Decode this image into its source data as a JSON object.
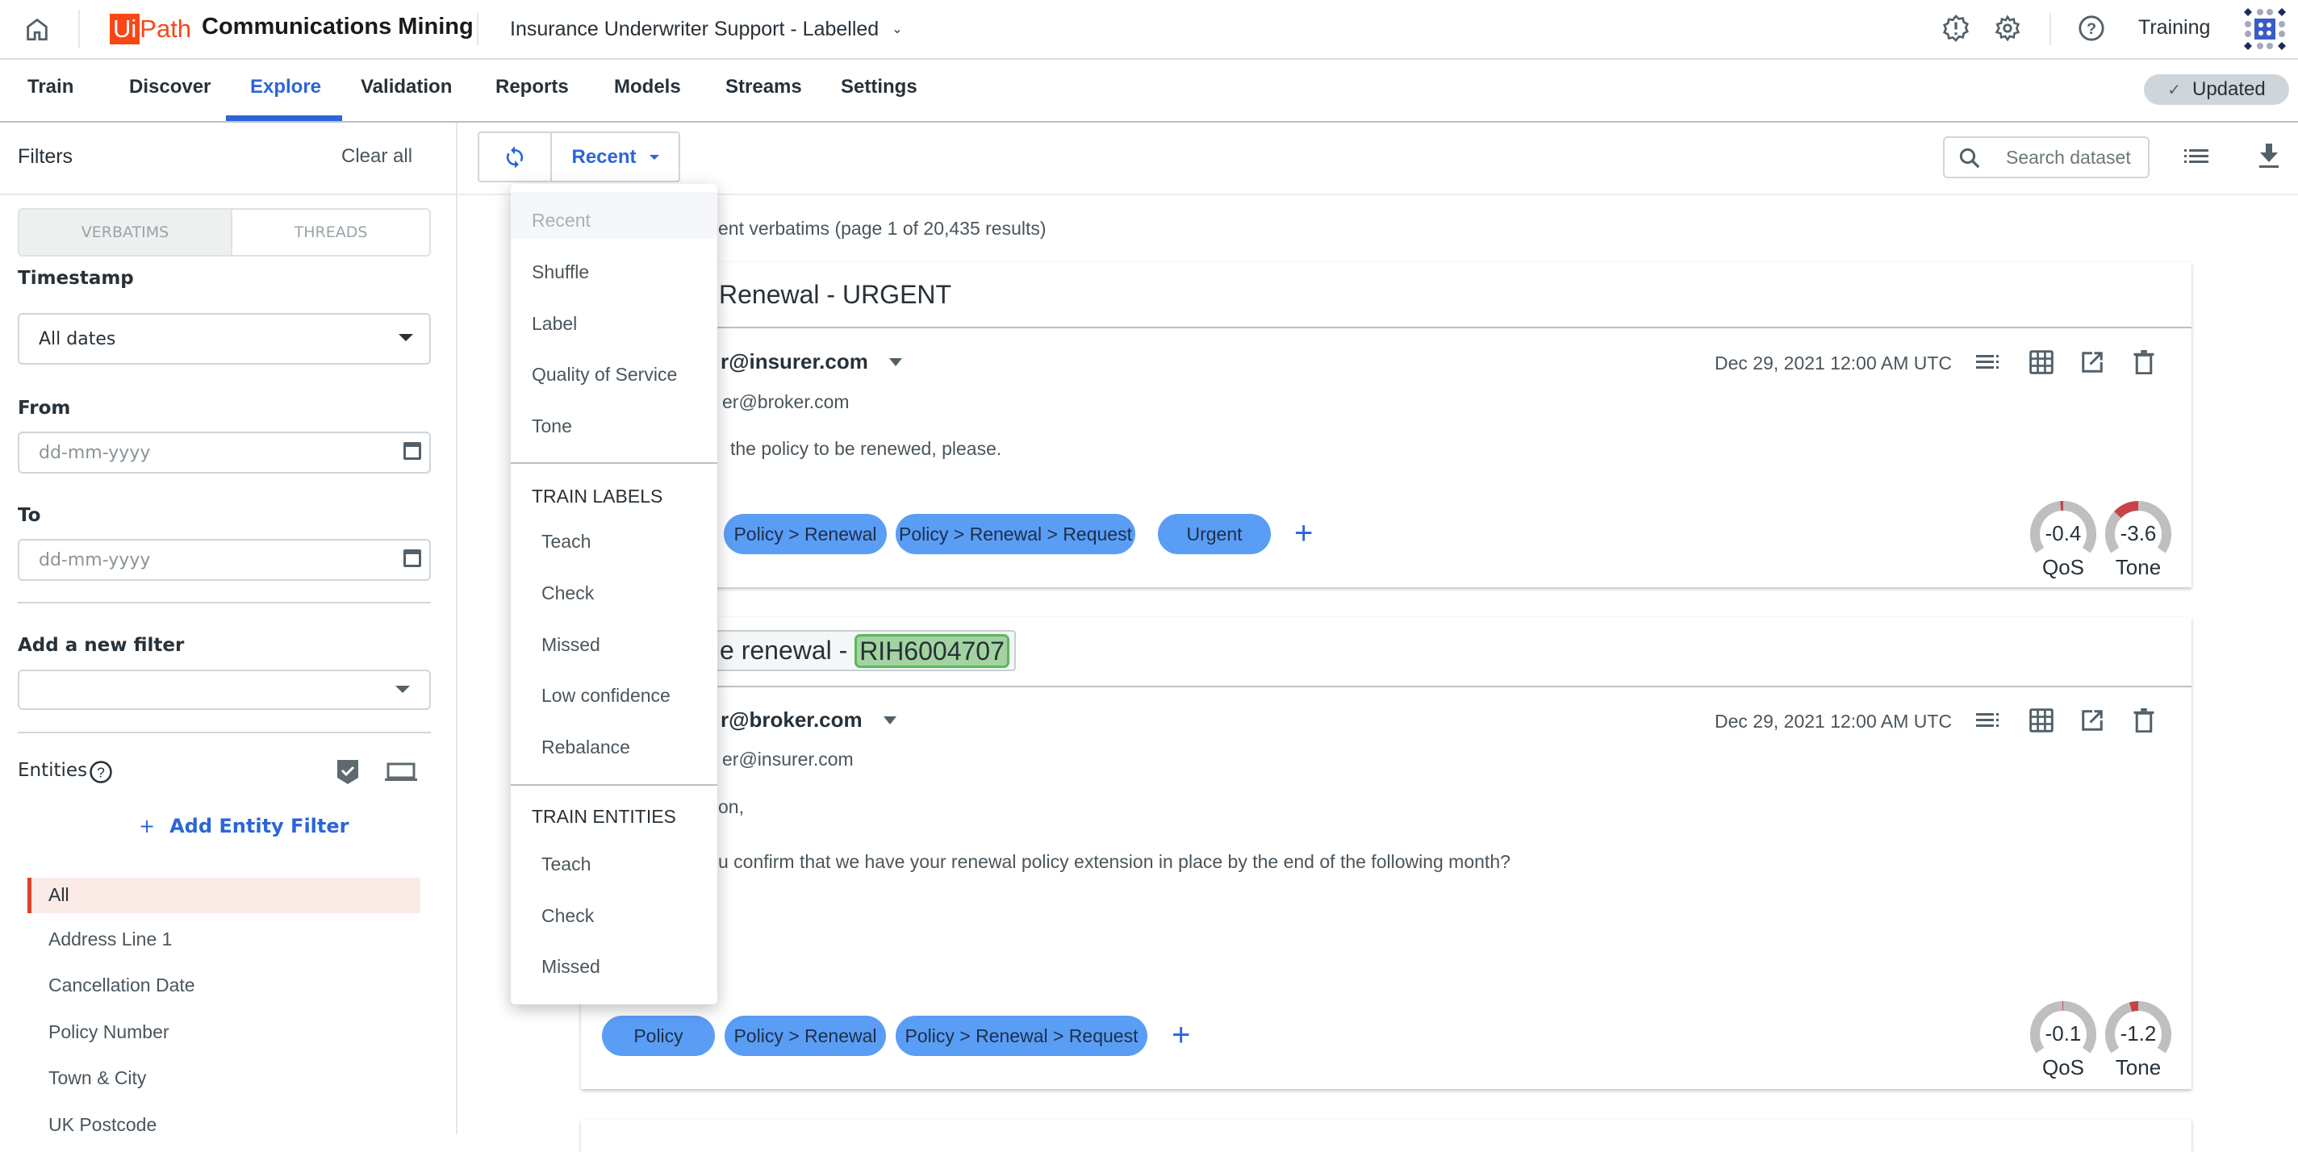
{
  "header": {
    "brand_logo": "UiPath",
    "product": "Communications Mining",
    "dataset": "Insurance Underwriter Support - Labelled",
    "user": "Training"
  },
  "nav": {
    "tabs": [
      "Train",
      "Discover",
      "Explore",
      "Validation",
      "Reports",
      "Models",
      "Streams",
      "Settings"
    ],
    "active": "Explore",
    "status": "Updated"
  },
  "colors": {
    "accent": "#2c66d6",
    "brand": "#fa4616",
    "label_pill": "#5a9df5",
    "entity": "#a3d3a0",
    "gauge_negative": "#c8424a"
  },
  "filters": {
    "title": "Filters",
    "clear_all": "Clear all",
    "toggle": [
      "VERBATIMS",
      "THREADS"
    ],
    "timestamp_label": "Timestamp",
    "timestamp_value": "All dates",
    "from_label": "From",
    "from_placeholder": "dd-mm-yyyy",
    "to_label": "To",
    "to_placeholder": "dd-mm-yyyy",
    "add_filter_label": "Add a new filter",
    "entities_label": "Entities",
    "add_entity_filter": "Add Entity Filter",
    "entities": [
      "All",
      "Address Line 1",
      "Cancellation Date",
      "Policy Number",
      "Town & City",
      "UK Postcode"
    ]
  },
  "toolbar": {
    "sort": "Recent",
    "search_placeholder": "Search dataset"
  },
  "sort_menu": {
    "items": [
      "Recent",
      "Shuffle",
      "Label",
      "Quality of Service",
      "Tone"
    ],
    "train_labels_header": "TRAIN LABELS",
    "train_labels": [
      "Teach",
      "Check",
      "Missed",
      "Low confidence",
      "Rebalance"
    ],
    "train_entities_header": "TRAIN ENTITIES",
    "train_entities": [
      "Teach",
      "Check",
      "Missed"
    ]
  },
  "results_text": "ent verbatims (page 1 of 20,435 results)",
  "cards": [
    {
      "subject": "Renewal - URGENT",
      "sender": "r@insurer.com",
      "recipient": "er@broker.com",
      "date": "Dec 29, 2021 12:00 AM UTC",
      "body": [
        "the policy to be renewed, please."
      ],
      "labels": [
        "Policy > Renewal",
        "Policy > Renewal > Request",
        "Urgent"
      ],
      "qos": -0.4,
      "tone": -3.6,
      "qos_label": "QoS",
      "tone_label": "Tone"
    },
    {
      "subject": "e renewal - ",
      "subject_entity": "RIH6004707",
      "sender": "r@broker.com",
      "recipient": "er@insurer.com",
      "date": "Dec 29, 2021 12:00 AM UTC",
      "body": [
        "on,",
        "u confirm that we have your renewal policy extension in place by the end of the following month?"
      ],
      "labels": [
        "Policy",
        "Policy > Renewal",
        "Policy > Renewal > Request"
      ],
      "qos": -0.1,
      "tone": -1.2,
      "qos_label": "QoS",
      "tone_label": "Tone"
    }
  ]
}
